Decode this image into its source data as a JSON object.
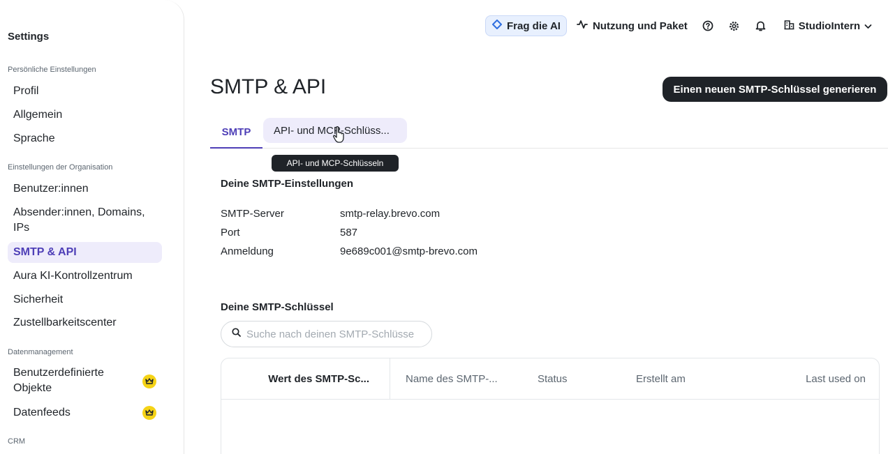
{
  "sidebar": {
    "title": "Settings",
    "sections": [
      {
        "label": "Persönliche Einstellungen"
      },
      {
        "label": "Einstellungen der Organisation"
      },
      {
        "label": "Datenmanagement"
      },
      {
        "label": "CRM"
      }
    ],
    "items": [
      {
        "label": "Profil"
      },
      {
        "label": "Allgemein"
      },
      {
        "label": "Sprache"
      },
      {
        "label": "Benutzer:innen"
      },
      {
        "label": "Absender:innen, Domains, IPs"
      },
      {
        "label": "SMTP & API",
        "active": true
      },
      {
        "label": "Aura KI-Kontrollzentrum"
      },
      {
        "label": "Sicherheit"
      },
      {
        "label": "Zustellbarkeitscenter"
      },
      {
        "label": "Benutzerdefinierte Objekte",
        "premium": true
      },
      {
        "label": "Datenfeeds",
        "premium": true
      }
    ]
  },
  "topbar": {
    "ask_ai": "Frag die AI",
    "usage": "Nutzung und Paket",
    "org_name": "StudioIntern",
    "icons": [
      "help-icon",
      "gear-icon",
      "bell-icon"
    ]
  },
  "main": {
    "title": "SMTP & API",
    "primary_button": "Einen neuen SMTP-Schlüssel generieren",
    "tabs": [
      {
        "label": "SMTP",
        "active": true
      },
      {
        "label": "API- und MCP-Schlüss..."
      }
    ],
    "tooltip": "API- und MCP-Schlüsseln",
    "smtp_settings": {
      "heading": "Deine SMTP-Einstellungen",
      "rows": [
        {
          "label": "SMTP-Server",
          "value": "smtp-relay.brevo.com"
        },
        {
          "label": "Port",
          "value": "587"
        },
        {
          "label": "Anmeldung",
          "value": "9e689c001@smtp-brevo.com"
        }
      ]
    },
    "smtp_keys": {
      "heading": "Deine SMTP-Schlüssel",
      "search_placeholder": "Suche nach deinen SMTP-Schlüsse",
      "columns": [
        "Wert des SMTP-Sc...",
        "Name des SMTP-...",
        "Status",
        "Erstellt am",
        "Last used on"
      ]
    }
  },
  "colors": {
    "accent": "#4e3fb7",
    "accent_bg": "#eeecfb",
    "dark": "#1f2328",
    "ai_bg": "#e8f0fe",
    "premium": "#f5d316"
  }
}
